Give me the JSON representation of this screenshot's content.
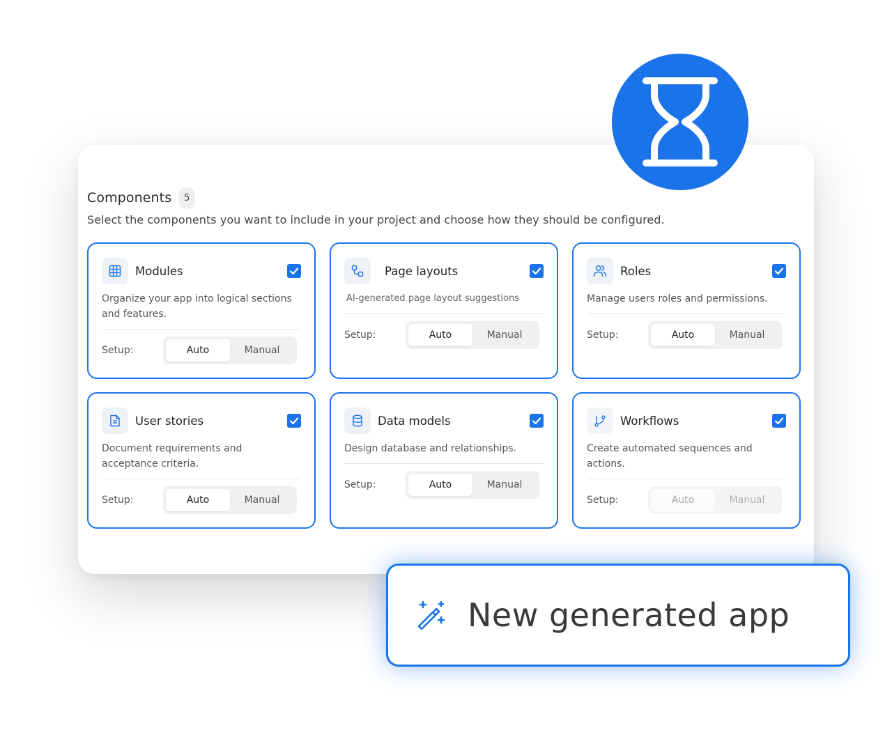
{
  "header": {
    "title": "Components",
    "count": "5",
    "subtitle": "Select the components you want to include in your project and choose how they should be configured."
  },
  "status_icon": "hourglass-icon",
  "accent_color": "#1a73e8",
  "components": [
    {
      "title": "Modules",
      "icon": "table-grid-icon",
      "checked": true,
      "description": "Organize your app into logical sections and features.",
      "setup_label": "Setup:",
      "options": [
        "Auto",
        "Manual"
      ],
      "selected": "Auto",
      "disabled": false
    },
    {
      "title": "Page layouts",
      "icon": "layout-nodes-icon",
      "checked": true,
      "description": "AI-generated page layout suggestions",
      "setup_label": "Setup:",
      "options": [
        "Auto",
        "Manual"
      ],
      "selected": "Auto",
      "disabled": false
    },
    {
      "title": "Roles",
      "icon": "users-icon",
      "checked": true,
      "description": "Manage users roles and permissions.",
      "setup_label": "Setup:",
      "options": [
        "Auto",
        "Manual"
      ],
      "selected": "Auto",
      "disabled": false
    },
    {
      "title": "User stories",
      "icon": "document-icon",
      "checked": true,
      "description": "Document requirements and acceptance criteria.",
      "setup_label": "Setup:",
      "options": [
        "Auto",
        "Manual"
      ],
      "selected": "Auto",
      "disabled": false
    },
    {
      "title": "Data models",
      "icon": "database-icon",
      "checked": true,
      "description": "Design database and relationships.",
      "setup_label": "Setup:",
      "options": [
        "Auto",
        "Manual"
      ],
      "selected": "Auto",
      "disabled": false
    },
    {
      "title": "Workflows",
      "icon": "workflow-branch-icon",
      "checked": true,
      "description": "Create automated sequences and actions.",
      "setup_label": "Setup:",
      "options": [
        "Auto",
        "Manual"
      ],
      "selected": "Auto",
      "disabled": true
    }
  ],
  "cta": {
    "label": "New generated app",
    "icon": "magic-wand-icon"
  }
}
